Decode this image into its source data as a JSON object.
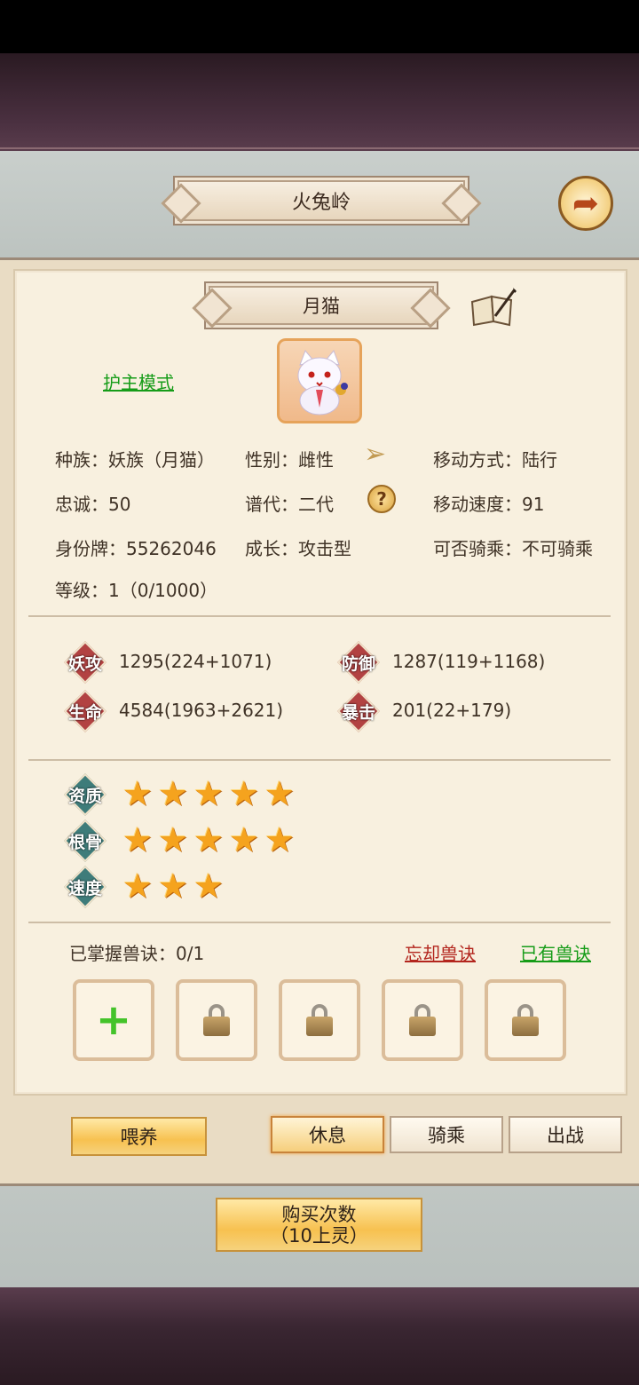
{
  "header": {
    "location_title": "火兔岭",
    "back_icon": "back-arrow-icon"
  },
  "pet": {
    "name": "月猫",
    "mode_link": "护主模式",
    "info": {
      "race": "种族：妖族（月猫）",
      "gender": "性别：雌性",
      "move_type": "移动方式：陆行",
      "loyalty": "忠诚：50",
      "generation": "谱代：二代",
      "move_speed": "移动速度：91",
      "id_tag": "身份牌：55262046",
      "growth": "成长：攻击型",
      "rideable": "可否骑乘：不可骑乘",
      "level": "等级：1（0/1000）"
    },
    "stats": [
      {
        "badge": "妖攻",
        "value": "1295(224+1071)"
      },
      {
        "badge": "防御",
        "value": "1287(119+1168)"
      },
      {
        "badge": "生命",
        "value": "4584(1963+2621)"
      },
      {
        "badge": "暴击",
        "value": "201(22+179)"
      }
    ],
    "ratings": [
      {
        "badge": "资质",
        "stars": 5
      },
      {
        "badge": "根骨",
        "stars": 5
      },
      {
        "badge": "速度",
        "stars": 3
      }
    ],
    "skills": {
      "mastered": "已掌握兽诀：0/1",
      "forget_link": "忘却兽诀",
      "owned_link": "已有兽诀",
      "slots": [
        "add",
        "locked",
        "locked",
        "locked",
        "locked"
      ]
    }
  },
  "actions": {
    "feed": "喂养",
    "rest": "休息",
    "ride": "骑乘",
    "battle": "出战"
  },
  "buy": {
    "line1": "购买次数",
    "line2": "（10上灵）"
  },
  "colors": {
    "link_green": "#169c18",
    "link_red": "#b3261e",
    "star": "#f5a31e",
    "gold_button": "#f7c150"
  }
}
